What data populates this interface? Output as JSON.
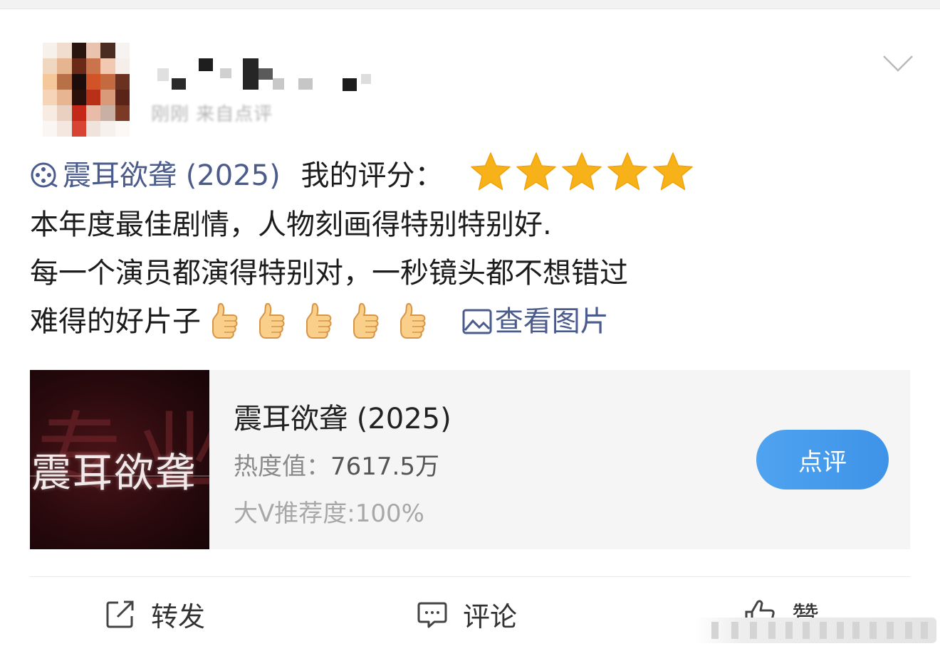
{
  "header": {
    "username": "",
    "meta": "刚刚 来自点评"
  },
  "review": {
    "movie_link": "震耳欲聋 (2025)",
    "rating_label": "我的评分：",
    "rating_stars": 5,
    "rating_max": 5,
    "line2": "本年度最佳剧情，人物刻画得特别特别好.",
    "line3": "每一个演员都演得特别对，一秒镜头都不想错过",
    "line4": "难得的好片子",
    "thumbs_count": 5,
    "view_images": "查看图片"
  },
  "movie_card": {
    "poster_title": "震耳欲聋",
    "poster_bg_text": "专业",
    "title": "震耳欲聋 (2025)",
    "heat_label": "热度值：",
    "heat_value": "7617.5万",
    "recommend": "大V推荐度:100%",
    "button_label": "点评"
  },
  "actions": {
    "repost": "转发",
    "comment": "评论",
    "like": "赞"
  },
  "colors": {
    "link": "#4a5b8c",
    "star": "#f7b21a",
    "button": "#4fa3f0"
  },
  "icons": [
    "film-reel-icon",
    "star-icon",
    "thumbs-up-icon",
    "image-icon",
    "chevron-down-icon",
    "repost-icon",
    "comment-icon",
    "like-icon"
  ]
}
